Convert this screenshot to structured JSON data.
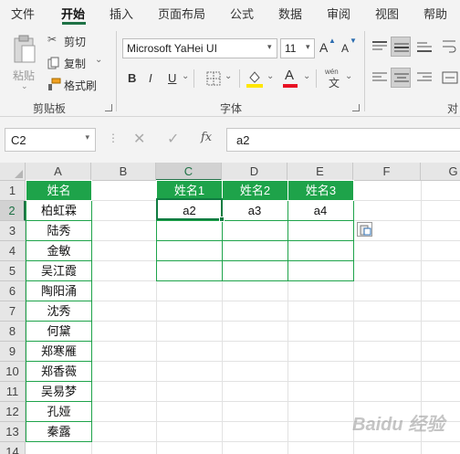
{
  "menu": {
    "tabs": [
      "文件",
      "开始",
      "插入",
      "页面布局",
      "公式",
      "数据",
      "审阅",
      "视图",
      "帮助"
    ],
    "active": "开始"
  },
  "ribbon": {
    "clipboard": {
      "paste": "粘贴",
      "cut": "剪切",
      "copy": "复制",
      "format_painter": "格式刷",
      "label": "剪贴板"
    },
    "font": {
      "family": "Microsoft YaHei UI",
      "size": "11",
      "grow": "A",
      "shrink": "A",
      "bold": "B",
      "italic": "I",
      "underline": "U",
      "font_color_letter": "A",
      "phonetic": "wén",
      "label": "字体",
      "highlight_color": "#ffe600",
      "font_color": "#e81123"
    },
    "align": {
      "label": "对"
    }
  },
  "formula_bar": {
    "name_box": "C2",
    "fx": "fx",
    "value": "a2"
  },
  "sheet": {
    "columns": [
      "A",
      "B",
      "C",
      "D",
      "E",
      "F",
      "G"
    ],
    "rows": [
      "1",
      "2",
      "3",
      "4",
      "5",
      "6",
      "7",
      "8",
      "9",
      "10",
      "11",
      "12",
      "13",
      "14"
    ],
    "selected_column": "C",
    "selected_row": "2",
    "header_A": "姓名",
    "names": [
      "柏虹霖",
      "陆秀",
      "金敏",
      "吴江霞",
      "陶阳涌",
      "沈秀",
      "何黛",
      "郑寒雁",
      "郑香薇",
      "吴易梦",
      "孔娅",
      "秦露"
    ],
    "out_headers": [
      "姓名1",
      "姓名2",
      "姓名3"
    ],
    "out_values": [
      "a2",
      "a3",
      "a4"
    ],
    "accent_color": "#1ea34a"
  },
  "watermark": "Baidu 经验"
}
